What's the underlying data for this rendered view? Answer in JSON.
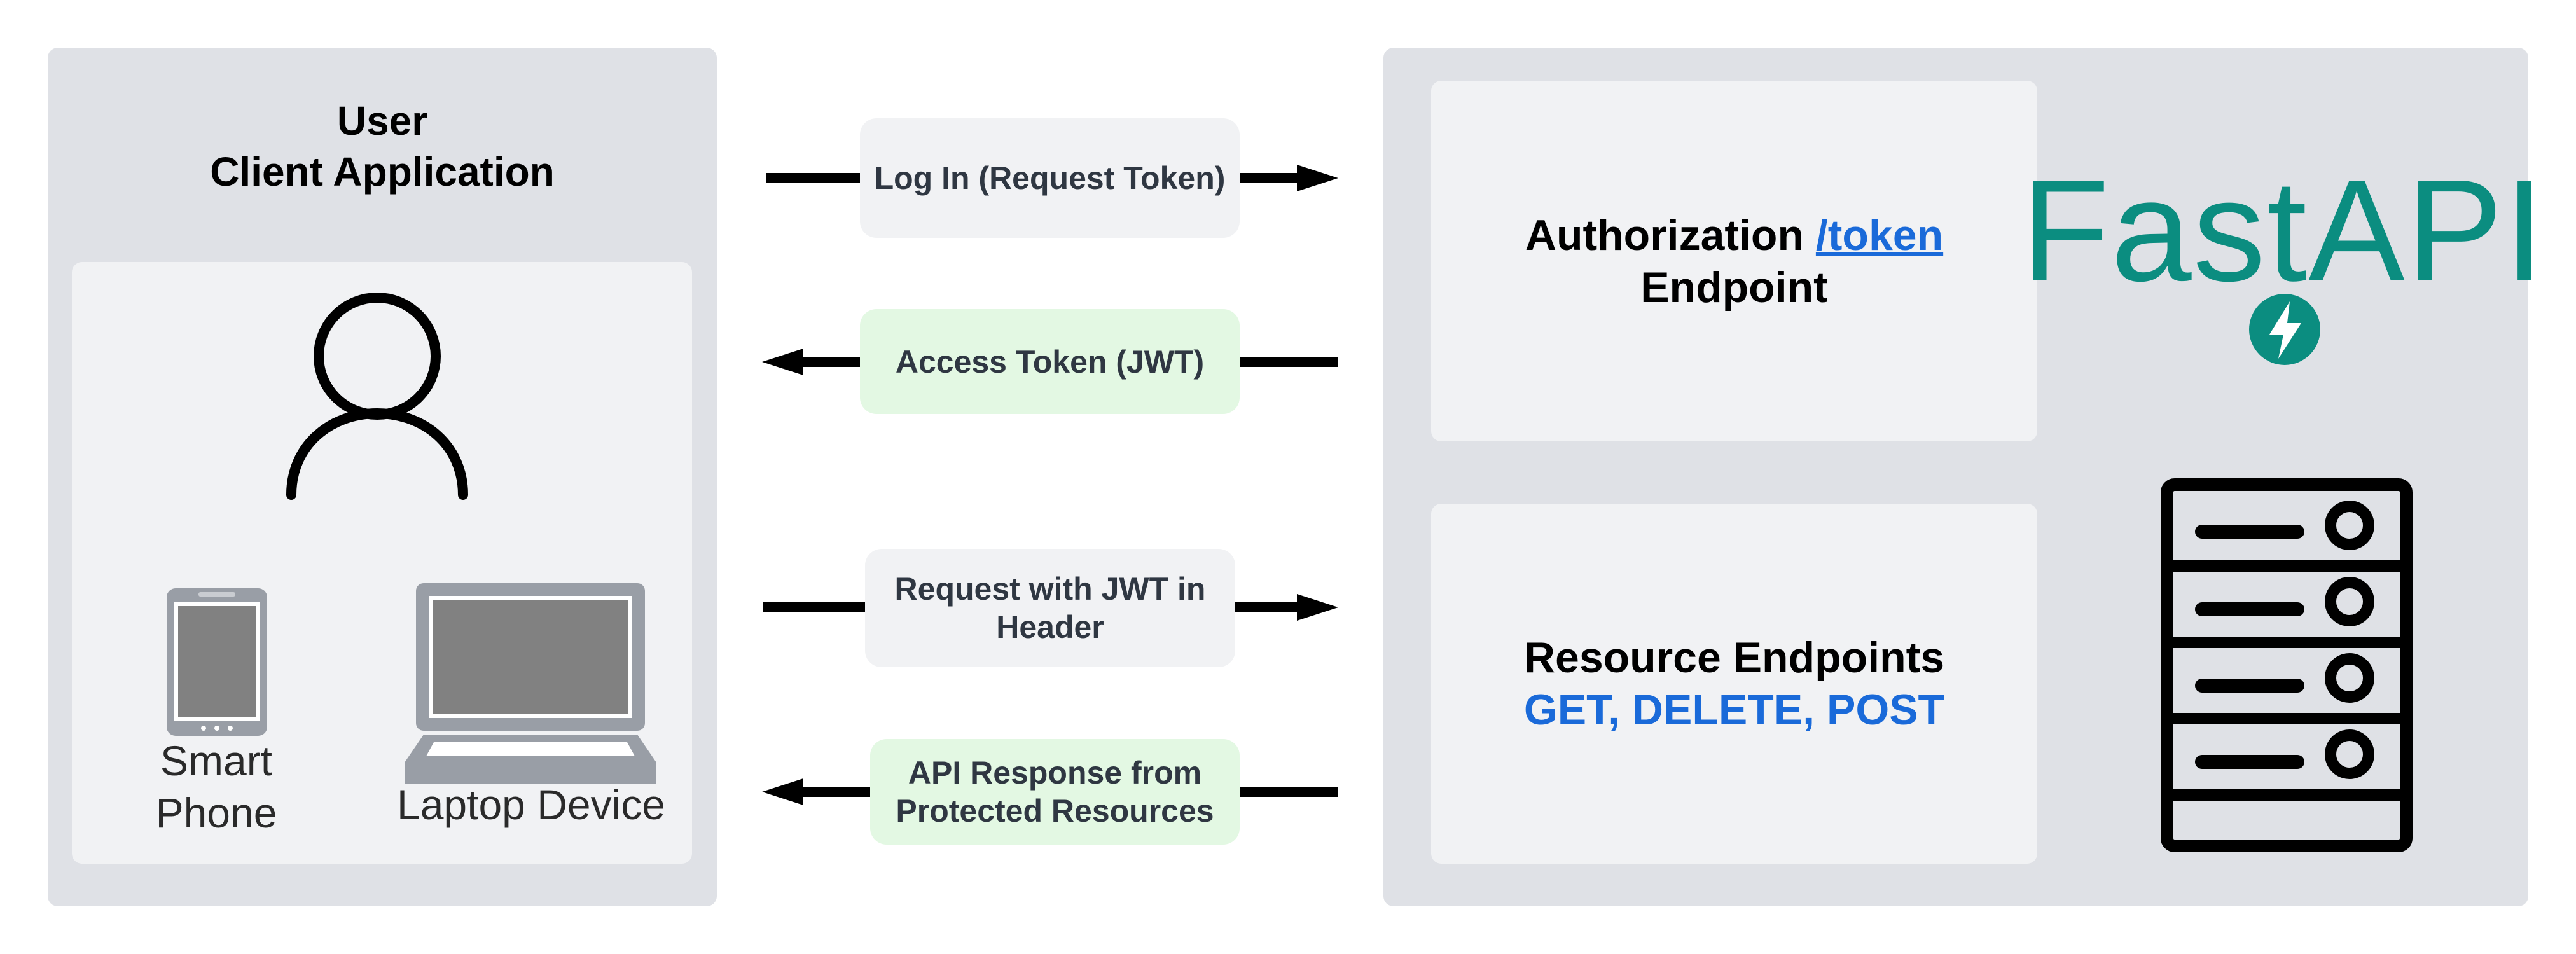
{
  "client": {
    "title_line1": "User",
    "title_line2": "Client Application",
    "devices": {
      "phone_line1": "Smart",
      "phone_line2": "Phone",
      "laptop": "Laptop Device"
    }
  },
  "messages": {
    "login": "Log In (Request Token)",
    "access_token": "Access Token (JWT)",
    "request_line1": "Request with JWT in",
    "request_line2": "Header",
    "response_line1": "API Response from",
    "response_line2": "Protected Resources"
  },
  "server": {
    "auth": {
      "prefix": "Authorization ",
      "link": "/token",
      "line2": "Endpoint"
    },
    "resources": {
      "title": "Resource Endpoints",
      "methods": "GET, DELETE, POST"
    },
    "brand": {
      "name": "FastAPI",
      "color": "#0b8d80"
    }
  },
  "colors": {
    "panel": "#dfe1e6",
    "inner": "#f1f2f4",
    "green_box": "#e3f8e3",
    "link_blue": "#1a6ad9",
    "device_gray": "#999ea6"
  },
  "icons": [
    "user-icon",
    "tablet-icon",
    "laptop-icon",
    "fastapi-logo",
    "bolt-icon",
    "server-rack-icon",
    "arrow-right",
    "arrow-left"
  ]
}
